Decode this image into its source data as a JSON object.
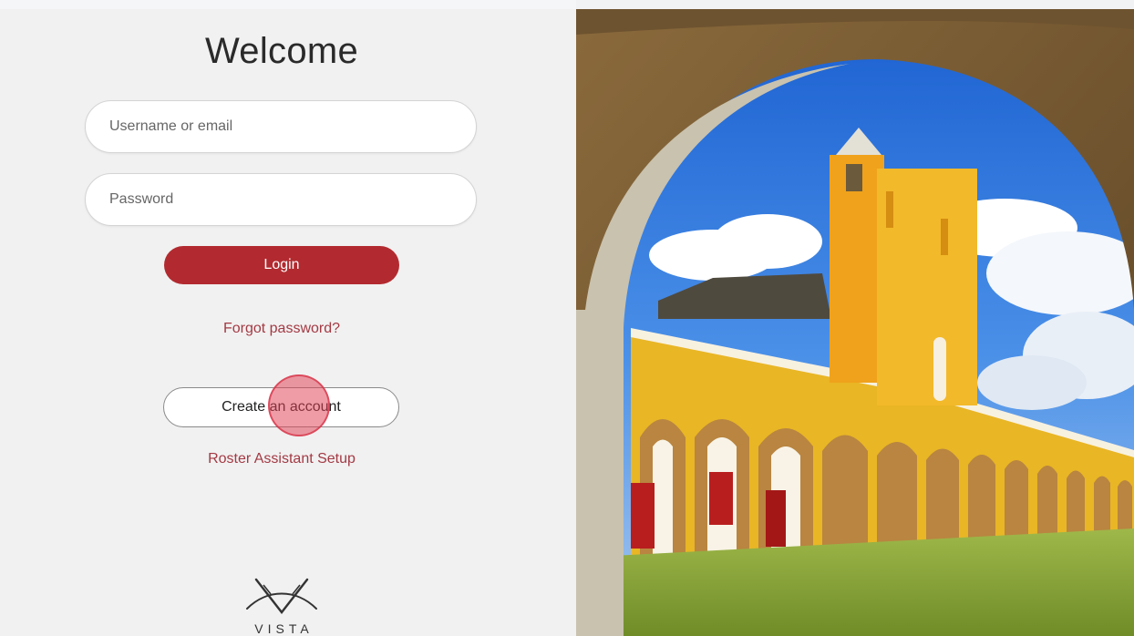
{
  "login": {
    "title": "Welcome",
    "username_placeholder": "Username or email",
    "password_placeholder": "Password",
    "login_label": "Login",
    "forgot_label": "Forgot password?",
    "create_account_label": "Create an account",
    "roster_label": "Roster Assistant Setup"
  },
  "brand": {
    "logo_text": "VISTA",
    "accent_color": "#b22a2f",
    "link_color": "#a33a44"
  },
  "icons": {
    "logo": "vista-logo-icon",
    "click_indicator": "click-marker"
  }
}
